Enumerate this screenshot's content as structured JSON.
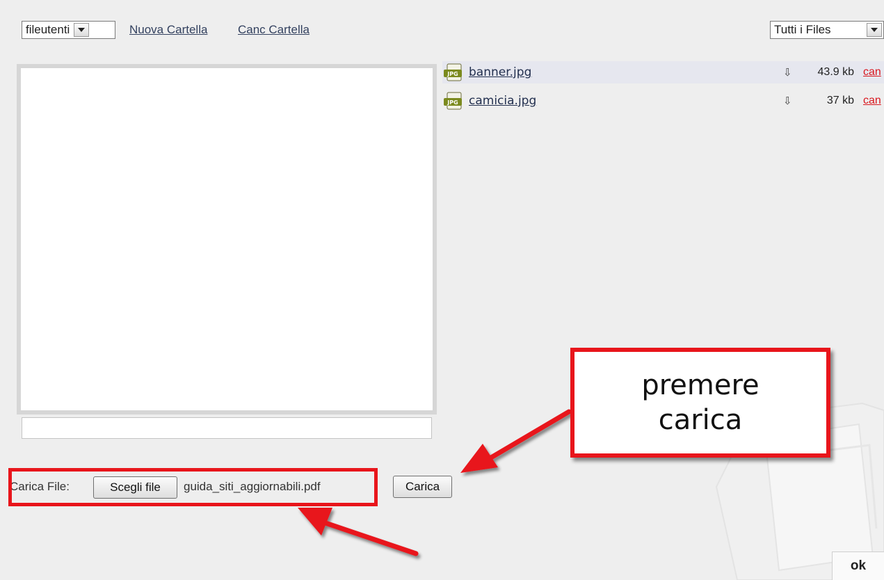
{
  "toolbar": {
    "folder_select_value": "fileutenti",
    "new_folder_link": "Nuova Cartella",
    "delete_folder_link": "Canc Cartella",
    "filter_select_value": "Tutti i Files"
  },
  "files": [
    {
      "name": "banner.jpg",
      "icon": "jpg-file-icon",
      "size": "43.9 kb",
      "delete_label": "can"
    },
    {
      "name": "camicia.jpg",
      "icon": "jpg-file-icon",
      "size": "37 kb",
      "delete_label": "can"
    }
  ],
  "upload": {
    "label": "Carica File:",
    "choose_button": "Scegli file",
    "chosen_filename": "guida_siti_aggiornabili.pdf",
    "upload_button": "Carica"
  },
  "annotation": {
    "callout_line1": "premere",
    "callout_line2": "carica",
    "accent_color": "#e8151b"
  },
  "footer": {
    "ok_button": "ok"
  }
}
